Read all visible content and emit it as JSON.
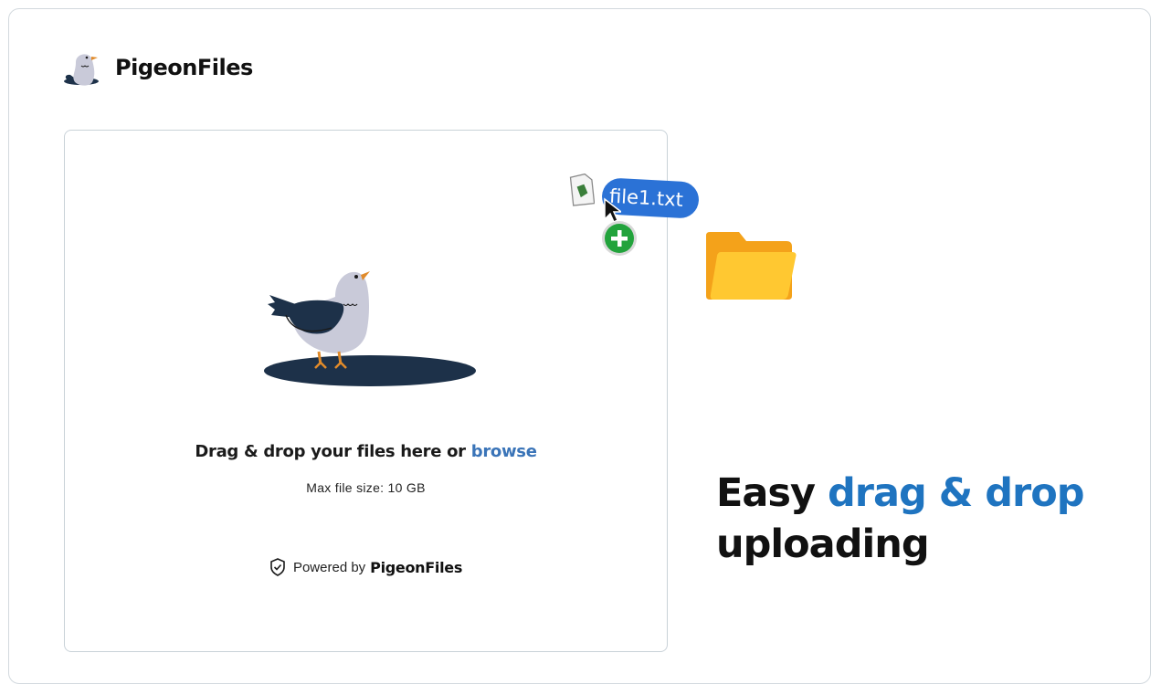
{
  "brand": {
    "name": "PigeonFiles",
    "logo_icon": "pigeon-icon"
  },
  "dropzone": {
    "prompt_text": "Drag & drop your files here or ",
    "browse_label": "browse",
    "max_size_text": "Max file size: 10 GB",
    "powered_by_text": "Powered by",
    "powered_by_brand": "PigeonFiles",
    "shield_icon": "shield-check-icon",
    "illustration": "pigeon-illustration"
  },
  "drag_overlay": {
    "file_name": "file1.txt",
    "file_icon": "text-file-icon",
    "add_icon": "plus-circle-icon",
    "cursor_icon": "cursor-arrow-icon"
  },
  "folder": {
    "icon": "folder-icon",
    "colors": {
      "back": "#f4a21a",
      "front": "#ffc831"
    }
  },
  "tagline": {
    "word1": "Easy",
    "accent": "drag & drop",
    "word2": "uploading"
  },
  "colors": {
    "accent": "#1f74c0",
    "link": "#3a74b8",
    "pill": "#2b72d6",
    "navy": "#1d3149",
    "pigeon_body": "#c9cad9",
    "beak": "#e08a2a",
    "plus_green": "#22a33c"
  }
}
